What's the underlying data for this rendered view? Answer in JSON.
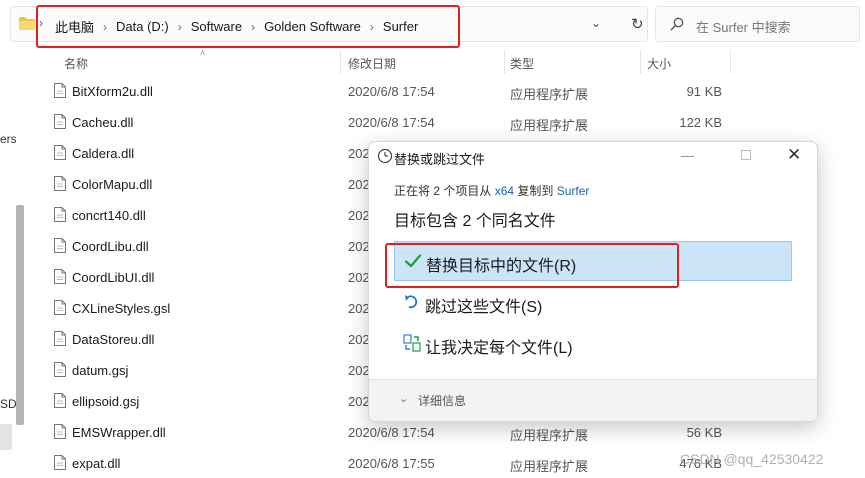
{
  "address_bar": {
    "breadcrumbs": [
      "此电脑",
      "Data (D:)",
      "Software",
      "Golden Software",
      "Surfer"
    ],
    "dropdown_glyph": "⌄",
    "refresh_glyph": "↻",
    "separator": "›"
  },
  "search": {
    "placeholder": "在 Surfer 中搜索"
  },
  "left_nav": {
    "partial_text_1": "ers",
    "partial_text_2": "SD"
  },
  "columns": {
    "name": "名称",
    "date": "修改日期",
    "type": "类型",
    "size": "大小"
  },
  "files": [
    {
      "name": "BitXform2u.dll",
      "date": "2020/6/8 17:54",
      "type": "应用程序扩展",
      "size": "91 KB"
    },
    {
      "name": "Cacheu.dll",
      "date": "2020/6/8 17:54",
      "type": "应用程序扩展",
      "size": "122 KB"
    },
    {
      "name": "Caldera.dll",
      "date": "202",
      "type": "",
      "size": ""
    },
    {
      "name": "ColorMapu.dll",
      "date": "202",
      "type": "",
      "size": ""
    },
    {
      "name": "concrt140.dll",
      "date": "202",
      "type": "",
      "size": ""
    },
    {
      "name": "CoordLibu.dll",
      "date": "202",
      "type": "",
      "size": ""
    },
    {
      "name": "CoordLibUI.dll",
      "date": "202",
      "type": "",
      "size": ""
    },
    {
      "name": "CXLineStyles.gsl",
      "date": "202",
      "type": "",
      "size": ""
    },
    {
      "name": "DataStoreu.dll",
      "date": "202",
      "type": "",
      "size": ""
    },
    {
      "name": "datum.gsj",
      "date": "202",
      "type": "",
      "size": ""
    },
    {
      "name": "ellipsoid.gsj",
      "date": "202",
      "type": "",
      "size": ""
    },
    {
      "name": "EMSWrapper.dll",
      "date": "2020/6/8 17:54",
      "type": "应用程序扩展",
      "size": "56 KB"
    },
    {
      "name": "expat.dll",
      "date": "2020/6/8 17:55",
      "type": "应用程序扩展",
      "size": "476 KB"
    }
  ],
  "dialog": {
    "title": "替换或跳过文件",
    "copying_prefix": "正在将 2 个项目从 ",
    "source": "x64",
    "copying_middle": " 复制到 ",
    "destination": "Surfer",
    "headline": "目标包含 2 个同名文件",
    "options": {
      "replace": "替换目标中的文件(R)",
      "skip": "跳过这些文件(S)",
      "decide": "让我决定每个文件(L)"
    },
    "details": "详细信息",
    "minimize_glyph": "—",
    "close_glyph": "✕"
  },
  "watermark": "CSDN @qq_42530422",
  "colors": {
    "accent_blue": "#1a62b7",
    "selection_bg": "#cce4f7",
    "annotation_red": "#e02020",
    "check_green": "#1e9e3a"
  },
  "icons": [
    "folder-icon",
    "search-icon",
    "refresh-icon",
    "file-icon",
    "clock-icon",
    "check-icon",
    "skip-arrow-icon",
    "compare-icon"
  ]
}
